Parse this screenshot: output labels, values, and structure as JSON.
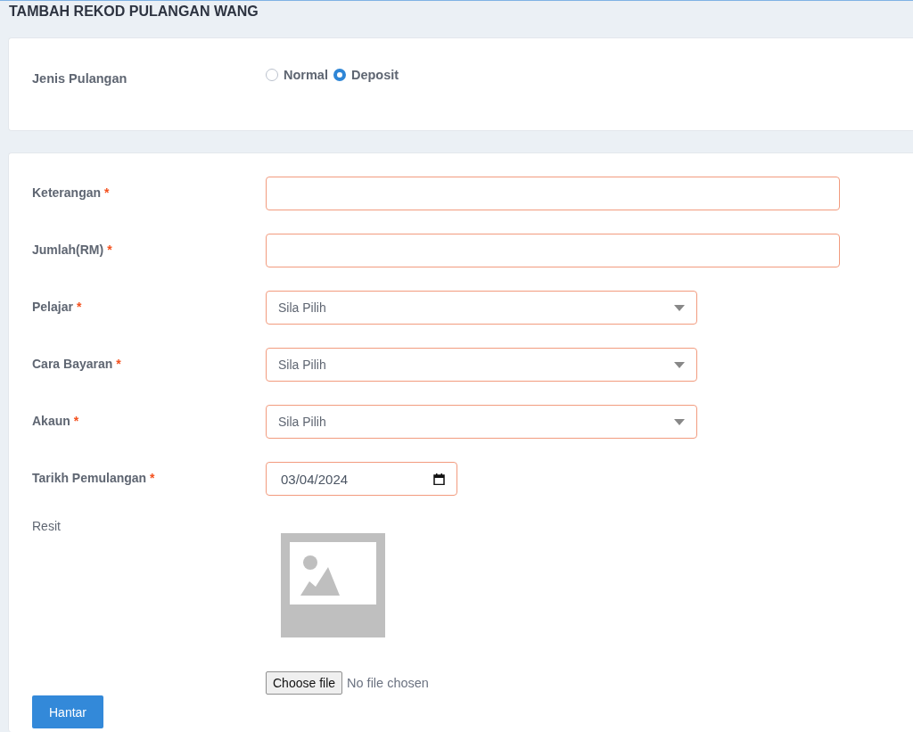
{
  "page": {
    "title": "TAMBAH REKOD PULANGAN WANG"
  },
  "type_section": {
    "label": "Jenis Pulangan",
    "options": [
      {
        "label": "Normal",
        "selected": false
      },
      {
        "label": "Deposit",
        "selected": true
      }
    ]
  },
  "fields": [
    {
      "kind": "text",
      "label": "Keterangan",
      "required_mark": "*"
    },
    {
      "kind": "text",
      "label": "Jumlah(RM)",
      "required_mark": "*"
    },
    {
      "kind": "select",
      "label": "Pelajar",
      "required_mark": "*",
      "value": "Sila Pilih"
    },
    {
      "kind": "select",
      "label": "Cara Bayaran",
      "required_mark": "*",
      "value": "Sila Pilih"
    },
    {
      "kind": "select",
      "label": "Akaun",
      "required_mark": "*",
      "value": "Sila Pilih"
    },
    {
      "kind": "date",
      "label": "Tarikh Pemulangan",
      "required_mark": "*",
      "value": "03/04/2024"
    },
    {
      "kind": "file",
      "label": "Resit",
      "button": "Choose file",
      "status": "No file chosen"
    }
  ],
  "submit_button": "Hantar"
}
